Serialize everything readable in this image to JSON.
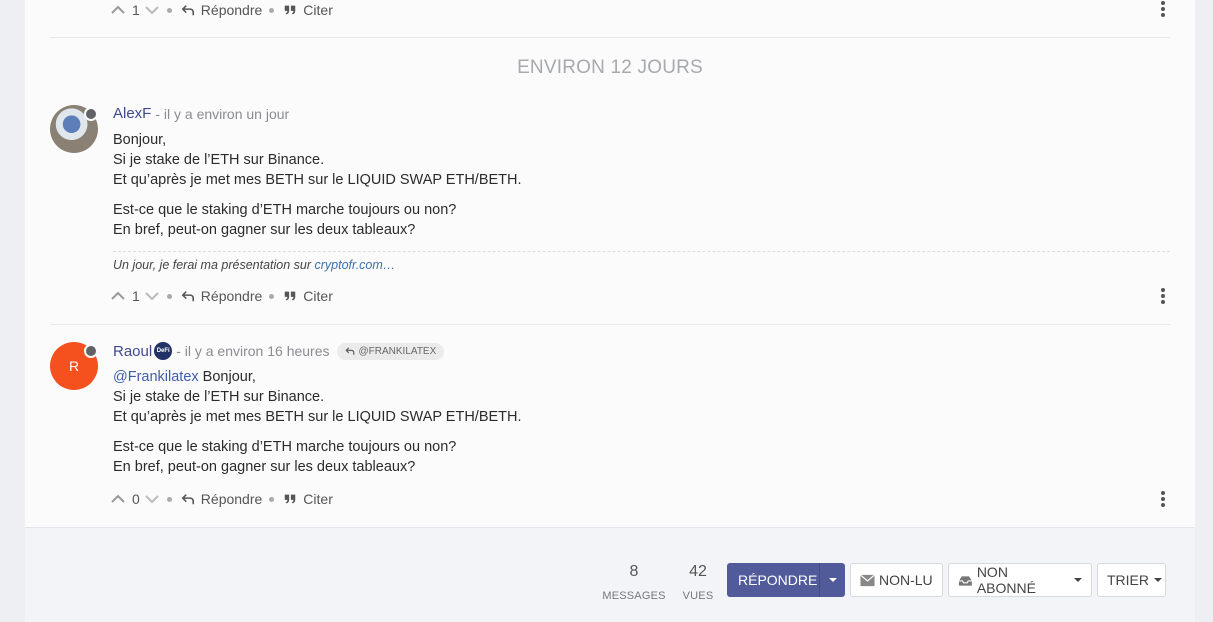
{
  "top_post": {
    "votes": "1",
    "reply_label": "Répondre",
    "quote_label": "Citer"
  },
  "divider": "ENVIRON 12 JOURS",
  "posts": [
    {
      "author": "AlexF",
      "time": "- il y a environ un jour",
      "avatar_initial": "",
      "paragraphs": [
        [
          "Bonjour,",
          "Si je stake de l’ETH sur Binance.",
          "Et qu’après je met mes BETH sur le LIQUID SWAP ETH/BETH."
        ],
        [
          "Est-ce que le staking d’ETH marche toujours ou non?",
          "En bref, peut-on gagner sur les deux tableaux?"
        ]
      ],
      "signature_text": "Un jour, je ferai ma présentation sur ",
      "signature_link": "cryptofr.com…",
      "votes": "1",
      "reply_label": "Répondre",
      "quote_label": "Citer"
    },
    {
      "author": "Raoul",
      "badge": "DeFi",
      "time": "- il y a environ 16 heures",
      "reply_to": "@FRANKILATEX",
      "avatar_initial": "R",
      "avatar_color": "#f4511e",
      "mention": "@Frankilatex",
      "first_line_rest": " Bonjour,",
      "paragraphs": [
        [
          "Si je stake de l’ETH sur Binance.",
          "Et qu’après je met mes BETH sur le LIQUID SWAP ETH/BETH."
        ],
        [
          "Est-ce que le staking d’ETH marche toujours ou non?",
          "En bref, peut-on gagner sur les deux tableaux?"
        ]
      ],
      "votes": "0",
      "reply_label": "Répondre",
      "quote_label": "Citer"
    }
  ],
  "stats": {
    "messages_count": "8",
    "messages_label": "MESSAGES",
    "views_count": "42",
    "views_label": "VUES"
  },
  "toolbar": {
    "reply": "RÉPONDRE",
    "unread": "NON-LU",
    "subscribe": "NON ABONNÉ",
    "sort": "TRIER"
  },
  "colors": {
    "accent": "#525b9a",
    "raoul_avatar": "#f4511e",
    "link": "#3e6fb0"
  }
}
